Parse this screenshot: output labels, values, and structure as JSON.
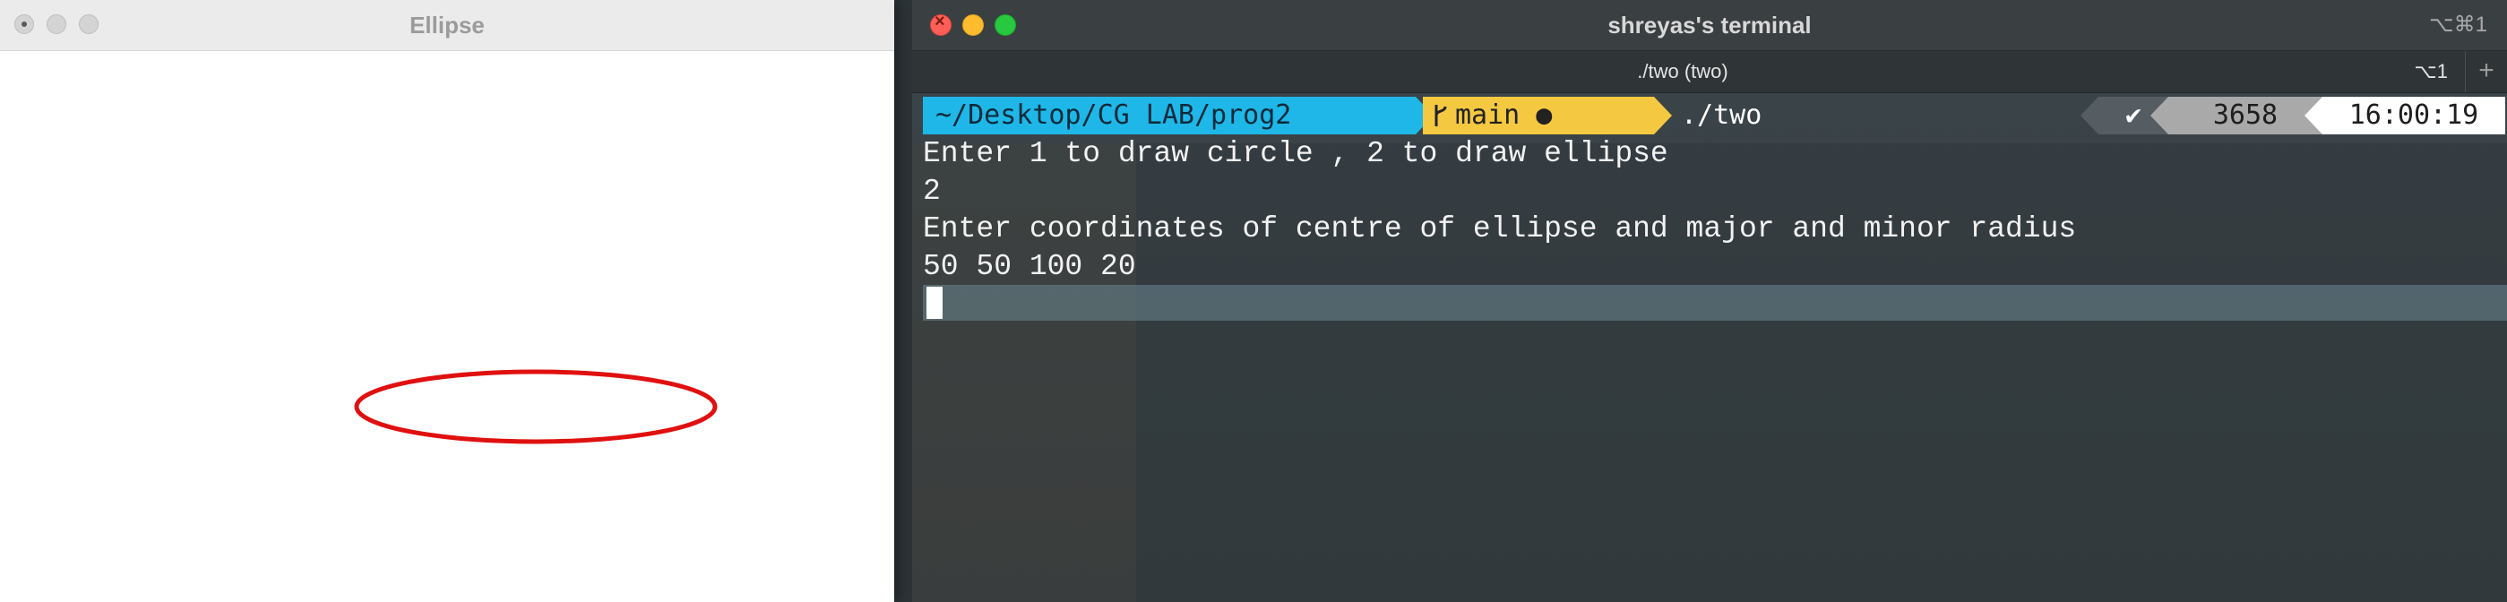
{
  "ellipse_window": {
    "title": "Ellipse",
    "ellipse_color": "#e01010"
  },
  "terminal": {
    "title": "shreyas's terminal",
    "title_shortcut": "⌥⌘1",
    "tab": {
      "label": "./two (two)",
      "shortcut": "⌥1",
      "new_tab": "+"
    },
    "prompt": {
      "path": "~/Desktop/CG LAB/prog2",
      "git_icon": "branch-icon",
      "git_branch": "main ●",
      "command": "./two",
      "status": "✔",
      "jobs": "3658",
      "time": "16:00:19"
    },
    "output": [
      "Enter 1 to draw circle , 2 to draw ellipse",
      "2",
      "Enter coordinates of centre of ellipse and major and minor radius",
      "50 50 100 20"
    ],
    "colors": {
      "path_segment": "#1fb7e8",
      "git_segment": "#f5c842",
      "status_segment": "#555d62",
      "jobs_segment": "#a9a9a9",
      "time_segment": "#ffffff"
    }
  }
}
